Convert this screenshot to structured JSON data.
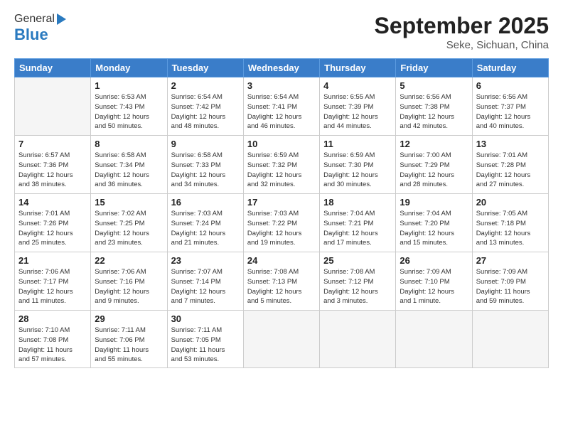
{
  "header": {
    "logo_general": "General",
    "logo_blue": "Blue",
    "month_title": "September 2025",
    "location": "Seke, Sichuan, China"
  },
  "weekdays": [
    "Sunday",
    "Monday",
    "Tuesday",
    "Wednesday",
    "Thursday",
    "Friday",
    "Saturday"
  ],
  "weeks": [
    [
      {
        "day": "",
        "info": ""
      },
      {
        "day": "1",
        "info": "Sunrise: 6:53 AM\nSunset: 7:43 PM\nDaylight: 12 hours\nand 50 minutes."
      },
      {
        "day": "2",
        "info": "Sunrise: 6:54 AM\nSunset: 7:42 PM\nDaylight: 12 hours\nand 48 minutes."
      },
      {
        "day": "3",
        "info": "Sunrise: 6:54 AM\nSunset: 7:41 PM\nDaylight: 12 hours\nand 46 minutes."
      },
      {
        "day": "4",
        "info": "Sunrise: 6:55 AM\nSunset: 7:39 PM\nDaylight: 12 hours\nand 44 minutes."
      },
      {
        "day": "5",
        "info": "Sunrise: 6:56 AM\nSunset: 7:38 PM\nDaylight: 12 hours\nand 42 minutes."
      },
      {
        "day": "6",
        "info": "Sunrise: 6:56 AM\nSunset: 7:37 PM\nDaylight: 12 hours\nand 40 minutes."
      }
    ],
    [
      {
        "day": "7",
        "info": "Sunrise: 6:57 AM\nSunset: 7:36 PM\nDaylight: 12 hours\nand 38 minutes."
      },
      {
        "day": "8",
        "info": "Sunrise: 6:58 AM\nSunset: 7:34 PM\nDaylight: 12 hours\nand 36 minutes."
      },
      {
        "day": "9",
        "info": "Sunrise: 6:58 AM\nSunset: 7:33 PM\nDaylight: 12 hours\nand 34 minutes."
      },
      {
        "day": "10",
        "info": "Sunrise: 6:59 AM\nSunset: 7:32 PM\nDaylight: 12 hours\nand 32 minutes."
      },
      {
        "day": "11",
        "info": "Sunrise: 6:59 AM\nSunset: 7:30 PM\nDaylight: 12 hours\nand 30 minutes."
      },
      {
        "day": "12",
        "info": "Sunrise: 7:00 AM\nSunset: 7:29 PM\nDaylight: 12 hours\nand 28 minutes."
      },
      {
        "day": "13",
        "info": "Sunrise: 7:01 AM\nSunset: 7:28 PM\nDaylight: 12 hours\nand 27 minutes."
      }
    ],
    [
      {
        "day": "14",
        "info": "Sunrise: 7:01 AM\nSunset: 7:26 PM\nDaylight: 12 hours\nand 25 minutes."
      },
      {
        "day": "15",
        "info": "Sunrise: 7:02 AM\nSunset: 7:25 PM\nDaylight: 12 hours\nand 23 minutes."
      },
      {
        "day": "16",
        "info": "Sunrise: 7:03 AM\nSunset: 7:24 PM\nDaylight: 12 hours\nand 21 minutes."
      },
      {
        "day": "17",
        "info": "Sunrise: 7:03 AM\nSunset: 7:22 PM\nDaylight: 12 hours\nand 19 minutes."
      },
      {
        "day": "18",
        "info": "Sunrise: 7:04 AM\nSunset: 7:21 PM\nDaylight: 12 hours\nand 17 minutes."
      },
      {
        "day": "19",
        "info": "Sunrise: 7:04 AM\nSunset: 7:20 PM\nDaylight: 12 hours\nand 15 minutes."
      },
      {
        "day": "20",
        "info": "Sunrise: 7:05 AM\nSunset: 7:18 PM\nDaylight: 12 hours\nand 13 minutes."
      }
    ],
    [
      {
        "day": "21",
        "info": "Sunrise: 7:06 AM\nSunset: 7:17 PM\nDaylight: 12 hours\nand 11 minutes."
      },
      {
        "day": "22",
        "info": "Sunrise: 7:06 AM\nSunset: 7:16 PM\nDaylight: 12 hours\nand 9 minutes."
      },
      {
        "day": "23",
        "info": "Sunrise: 7:07 AM\nSunset: 7:14 PM\nDaylight: 12 hours\nand 7 minutes."
      },
      {
        "day": "24",
        "info": "Sunrise: 7:08 AM\nSunset: 7:13 PM\nDaylight: 12 hours\nand 5 minutes."
      },
      {
        "day": "25",
        "info": "Sunrise: 7:08 AM\nSunset: 7:12 PM\nDaylight: 12 hours\nand 3 minutes."
      },
      {
        "day": "26",
        "info": "Sunrise: 7:09 AM\nSunset: 7:10 PM\nDaylight: 12 hours\nand 1 minute."
      },
      {
        "day": "27",
        "info": "Sunrise: 7:09 AM\nSunset: 7:09 PM\nDaylight: 11 hours\nand 59 minutes."
      }
    ],
    [
      {
        "day": "28",
        "info": "Sunrise: 7:10 AM\nSunset: 7:08 PM\nDaylight: 11 hours\nand 57 minutes."
      },
      {
        "day": "29",
        "info": "Sunrise: 7:11 AM\nSunset: 7:06 PM\nDaylight: 11 hours\nand 55 minutes."
      },
      {
        "day": "30",
        "info": "Sunrise: 7:11 AM\nSunset: 7:05 PM\nDaylight: 11 hours\nand 53 minutes."
      },
      {
        "day": "",
        "info": ""
      },
      {
        "day": "",
        "info": ""
      },
      {
        "day": "",
        "info": ""
      },
      {
        "day": "",
        "info": ""
      }
    ]
  ]
}
